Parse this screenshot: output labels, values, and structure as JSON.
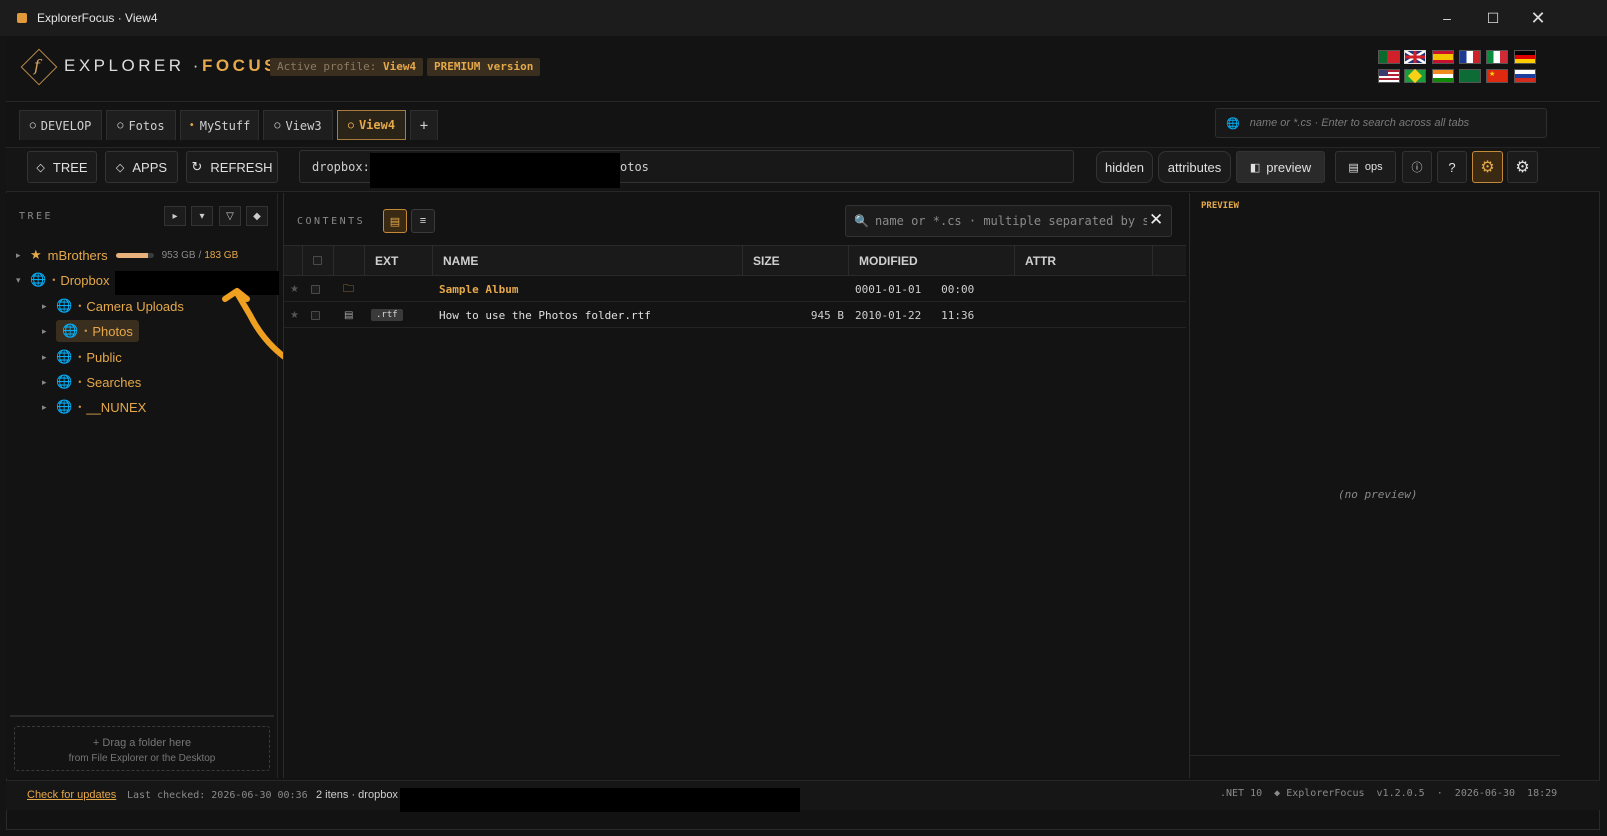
{
  "window": {
    "title": "ExplorerFocus  ·  View4"
  },
  "header": {
    "brand_main": "EXPLORER ·",
    "brand_accent": "FOCUS",
    "profile_prefix": "Active profile:",
    "profile_name": "View4",
    "edition": "PREMIUM version"
  },
  "flags": [
    "pt",
    "gb",
    "es",
    "fr",
    "it",
    "de",
    "us",
    "br",
    "in",
    "sa",
    "cn",
    "ru"
  ],
  "tabs": [
    {
      "label": "DEVELOP",
      "marker": "○"
    },
    {
      "label": "Fotos",
      "marker": "○"
    },
    {
      "label": "MyStuff",
      "marker": "•"
    },
    {
      "label": "View3",
      "marker": "○"
    },
    {
      "label": "View4",
      "marker": "○",
      "active": true
    },
    {
      "label": "+"
    }
  ],
  "global_search": {
    "placeholder": "name or *.cs  ·  Enter to search across all tabs"
  },
  "toolbar": {
    "tree": "TREE",
    "apps": "APPS",
    "refresh": "REFRESH",
    "address_prefix": "dropbox:/",
    "address_suffix": "otos",
    "hidden": "hidden",
    "attributes": "attributes",
    "preview": "preview",
    "ops": "ops"
  },
  "tree": {
    "label": "TREE",
    "root": {
      "name": "mBrothers",
      "used": "953 GB",
      "sep": "/",
      "total": "183 GB",
      "usage_fraction": 0.84
    },
    "dropbox": "Dropbox",
    "children": [
      "Camera Uploads",
      "Photos",
      "Public",
      "Searches",
      "__NUNEX"
    ],
    "selected": "Photos",
    "dropzone_title": "+  Drag a folder here",
    "dropzone_sub": "from File Explorer or the Desktop"
  },
  "contents": {
    "label": "CONTENTS",
    "filter_placeholder": "name  or  *.cs  ·  multiple separated by spa",
    "columns": [
      "EXT",
      "NAME",
      "SIZE",
      "MODIFIED",
      "ATTR"
    ],
    "rows": [
      {
        "type": "folder",
        "ext": "",
        "name": "Sample Album",
        "size": "",
        "modified": "0001-01-01   00:00",
        "attr": ""
      },
      {
        "type": "file",
        "ext": ".rtf",
        "name": "How to use the Photos folder.rtf",
        "size": "945 B",
        "modified": "2010-01-22   11:36",
        "attr": ""
      }
    ]
  },
  "preview": {
    "label": "PREVIEW",
    "empty": "(no preview)"
  },
  "status": {
    "check_updates": "Check for updates",
    "last_checked": "Last checked: 2026-06-30 00:36",
    "items": "2 itens  ·  dropbox",
    "right": ".NET 10  ◆ ExplorerFocus  v1.2.0.5  ·  2026-06-30  18:29"
  }
}
